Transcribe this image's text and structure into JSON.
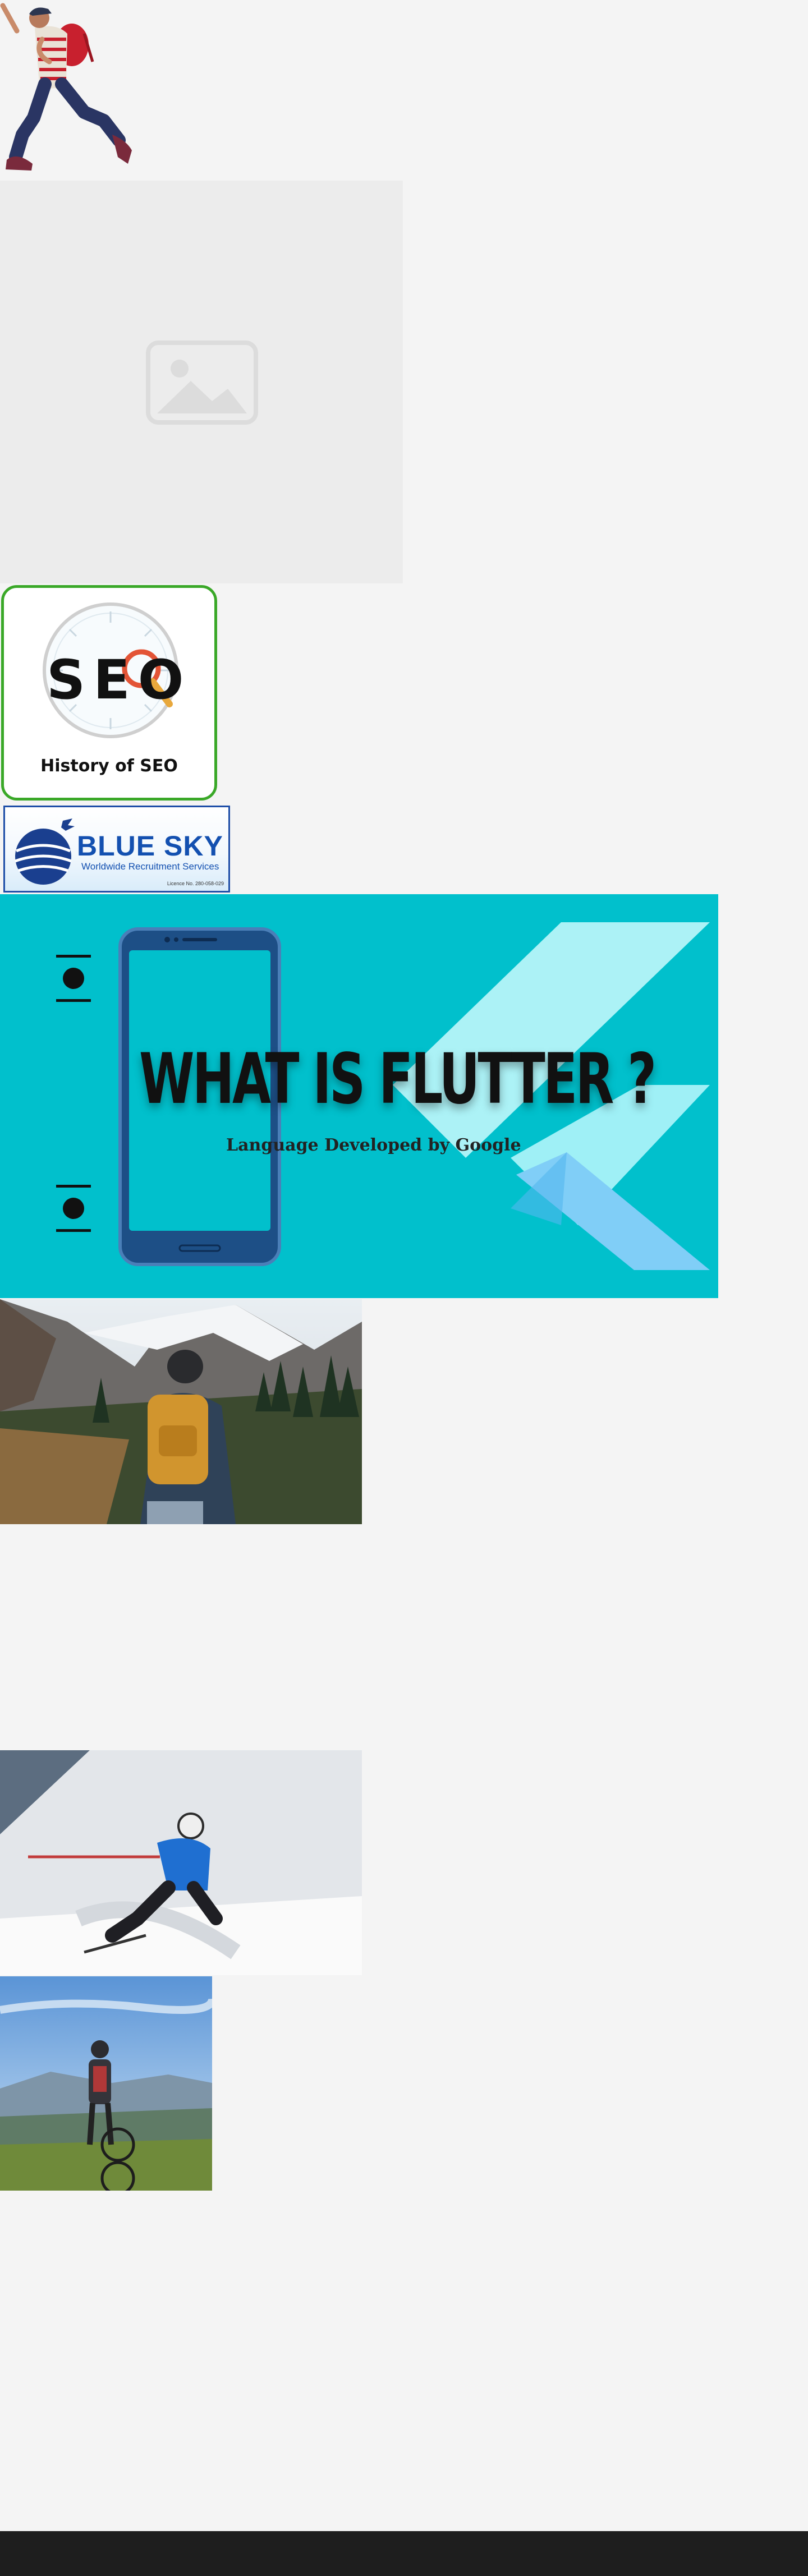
{
  "seo_card": {
    "logo_text": "SEO",
    "caption": "History of SEO"
  },
  "bluesky": {
    "title": "BLUE SKY",
    "subtitle": "Worldwide Recruitment Services",
    "license": "Licence No. 280-058-029"
  },
  "flutter_banner": {
    "title": "WHAT IS FLUTTER ?",
    "subtitle": "Language Developed by Google"
  },
  "colors": {
    "page_background": "#f4f4f4",
    "seo_border": "#3aa828",
    "bluesky_blue": "#1350b0",
    "flutter_background": "#01c0cc",
    "footer": "#1e1e1e"
  },
  "icons": [
    "image-placeholder-icon",
    "magnifier-icon",
    "globe-icon",
    "bird-icon",
    "flutter-logo-icon",
    "phone-icon"
  ]
}
